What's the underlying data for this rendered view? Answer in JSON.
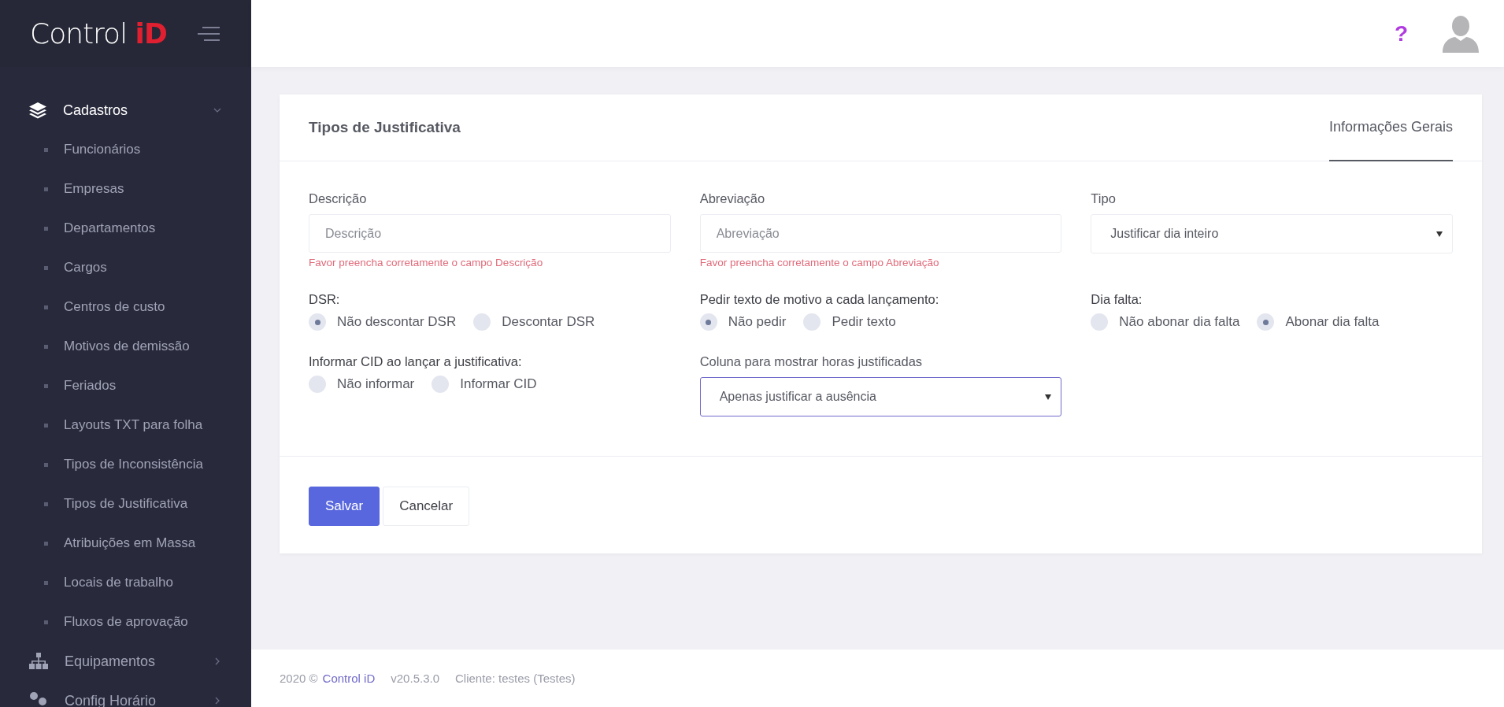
{
  "logo": {
    "text": "Control",
    "accent": "iD"
  },
  "sidebar": {
    "groups": [
      {
        "label": "Cadastros",
        "expanded": true,
        "children": [
          {
            "label": "Funcionários"
          },
          {
            "label": "Empresas"
          },
          {
            "label": "Departamentos"
          },
          {
            "label": "Cargos"
          },
          {
            "label": "Centros de custo"
          },
          {
            "label": "Motivos de demissão"
          },
          {
            "label": "Feriados"
          },
          {
            "label": "Layouts TXT para folha"
          },
          {
            "label": "Tipos de Inconsistência"
          },
          {
            "label": "Tipos de Justificativa"
          },
          {
            "label": "Atribuições em Massa"
          },
          {
            "label": "Locais de trabalho"
          },
          {
            "label": "Fluxos de aprovação"
          }
        ]
      },
      {
        "label": "Equipamentos",
        "expanded": false
      },
      {
        "label": "Config Horário",
        "expanded": false
      }
    ]
  },
  "header": {
    "help": "?"
  },
  "card": {
    "title": "Tipos de Justificativa",
    "tabs": [
      {
        "label": "Informações Gerais",
        "selected": true
      }
    ],
    "fields": [
      {
        "kind": "text",
        "label": "Descrição",
        "placeholder": "Descrição",
        "error": "Favor preencha corretamente o campo Descrição"
      },
      {
        "kind": "text",
        "label": "Abreviação",
        "placeholder": "Abreviação",
        "error": "Favor preencha corretamente o campo Abreviação"
      },
      {
        "kind": "select",
        "label": "Tipo",
        "value": "Justificar dia inteiro",
        "focused": false
      },
      {
        "kind": "radio",
        "label": "DSR:",
        "options": [
          {
            "label": "Não descontar DSR",
            "selected": true
          },
          {
            "label": "Descontar DSR",
            "selected": false
          }
        ]
      },
      {
        "kind": "radio",
        "label": "Pedir texto de motivo a cada lançamento:",
        "options": [
          {
            "label": "Não pedir",
            "selected": true
          },
          {
            "label": "Pedir texto",
            "selected": false
          }
        ]
      },
      {
        "kind": "radio",
        "label": "Dia falta:",
        "options": [
          {
            "label": "Não abonar dia falta",
            "selected": false
          },
          {
            "label": "Abonar dia falta",
            "selected": true
          }
        ]
      },
      {
        "kind": "radio",
        "label": "Informar CID ao lançar a justificativa:",
        "options": [
          {
            "label": "Não informar",
            "selected": false
          },
          {
            "label": "Informar CID",
            "selected": false
          }
        ]
      },
      {
        "kind": "select",
        "label": "Coluna para mostrar horas justificadas",
        "value": "Apenas justificar a ausência",
        "focused": true
      }
    ],
    "buttons": [
      {
        "label": "Salvar",
        "kind": "primary"
      },
      {
        "label": "Cancelar",
        "kind": "secondary"
      }
    ]
  },
  "footer": {
    "copyright": "2020 ©",
    "brand": "Control iD",
    "version": "v20.5.3.0",
    "client": "Cliente: testes (Testes)"
  }
}
